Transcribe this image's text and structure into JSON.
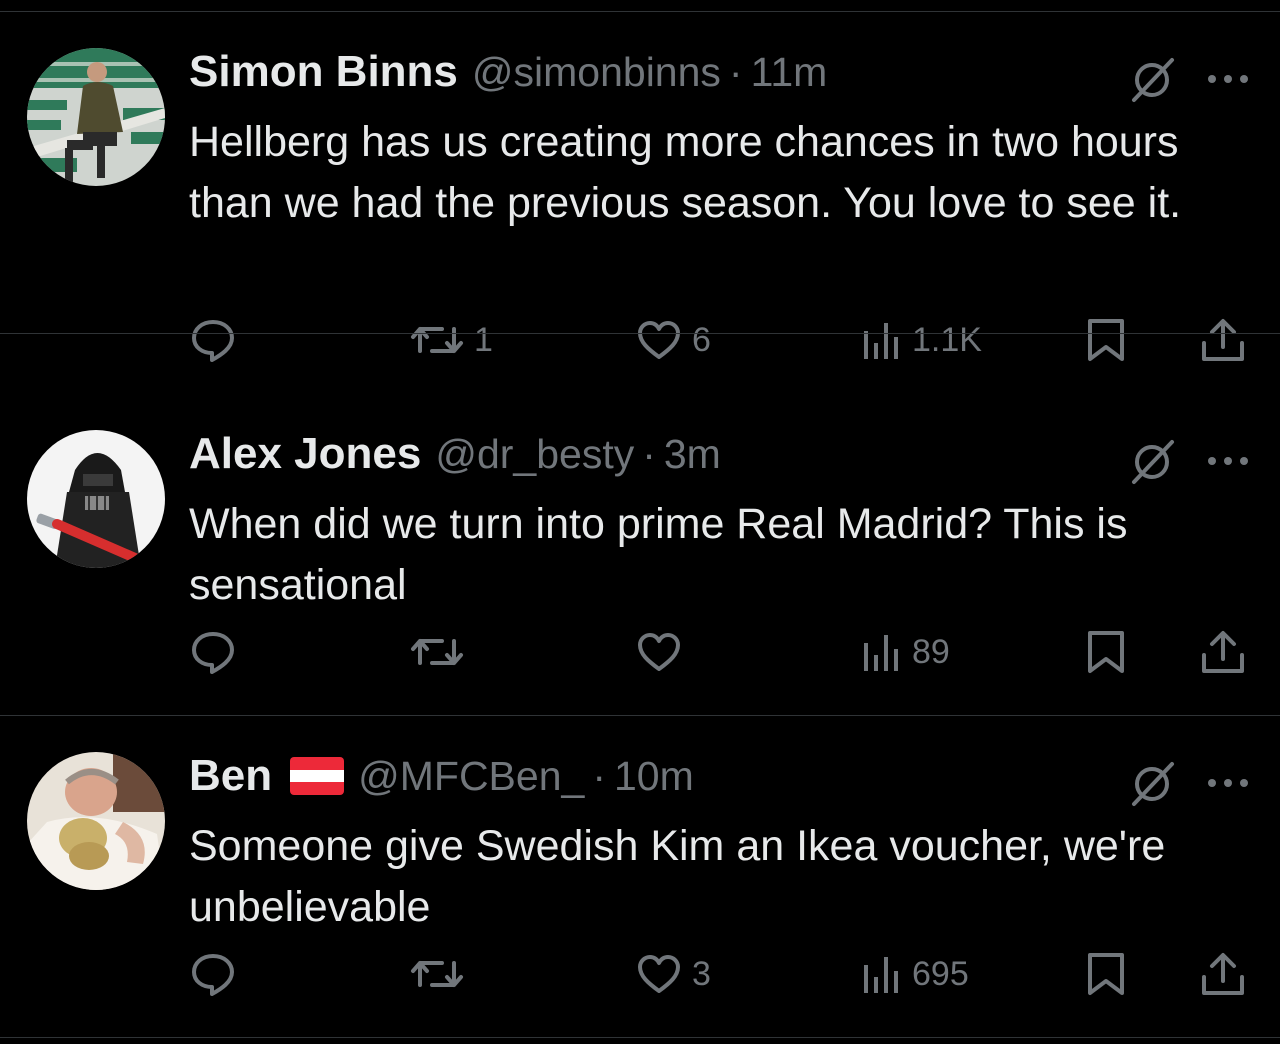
{
  "tweets": [
    {
      "name": "Simon Binns",
      "flag": "",
      "handle": "@simonbinns",
      "separator": "·",
      "time": "11m",
      "text": "Hellberg has us creating more chances in two hours than we had the previous season. You love to see it.",
      "replies": "",
      "retweets": "1",
      "likes": "6",
      "views": "1.1K",
      "avatar": "stadium-seat-photo"
    },
    {
      "name": "Alex Jones",
      "flag": "",
      "handle": "@dr_besty",
      "separator": "·",
      "time": "3m",
      "text": "When did we turn into prime Real Madrid? This is sensational",
      "replies": "",
      "retweets": "",
      "likes": "",
      "views": "89",
      "avatar": "darth-vader-figure"
    },
    {
      "name": "Ben",
      "flag": "austria-flag",
      "handle": "@MFCBen_",
      "separator": "·",
      "time": "10m",
      "text": "Someone give Swedish Kim an Ikea voucher, we're unbelievable",
      "replies": "",
      "retweets": "",
      "likes": "3",
      "views": "695",
      "avatar": "person-photo"
    }
  ],
  "icons": [
    "grok-icon",
    "more-icon",
    "reply-icon",
    "retweet-icon",
    "like-icon",
    "views-icon",
    "bookmark-icon",
    "share-icon"
  ],
  "colors": {
    "background": "#000000",
    "text": "#e7e9ea",
    "secondary": "#71767b",
    "divider": "#2f3336",
    "flag_red": "#ed2939"
  }
}
